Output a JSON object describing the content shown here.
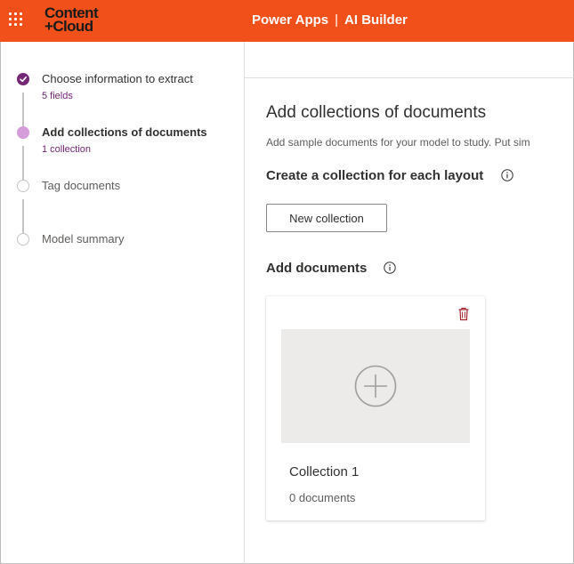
{
  "header": {
    "logo_line1": "Content",
    "logo_line2": "+Cloud",
    "app_name": "Power Apps",
    "separator": "|",
    "section_name": "AI Builder"
  },
  "steps": [
    {
      "title": "Choose information to extract",
      "subtitle": "5 fields",
      "state": "done"
    },
    {
      "title": "Add collections of documents",
      "subtitle": "1 collection",
      "state": "current"
    },
    {
      "title": "Tag documents",
      "subtitle": "",
      "state": "pending"
    },
    {
      "title": "Model summary",
      "subtitle": "",
      "state": "pending"
    }
  ],
  "main": {
    "heading": "Add collections of documents",
    "description": "Add sample documents for your model to study. Put sim",
    "create_heading": "Create a collection for each layout",
    "new_collection_button": "New collection",
    "add_documents_heading": "Add documents",
    "collection": {
      "name": "Collection 1",
      "count_label": "0 documents"
    }
  },
  "colors": {
    "header_bg": "#f2501b",
    "accent_purple": "#742774",
    "current_step": "#d59dd9",
    "delete_icon": "#a4262c"
  },
  "icons": [
    "waffle-icon",
    "checkmark-icon",
    "info-icon",
    "trash-icon",
    "add-circle-icon"
  ]
}
